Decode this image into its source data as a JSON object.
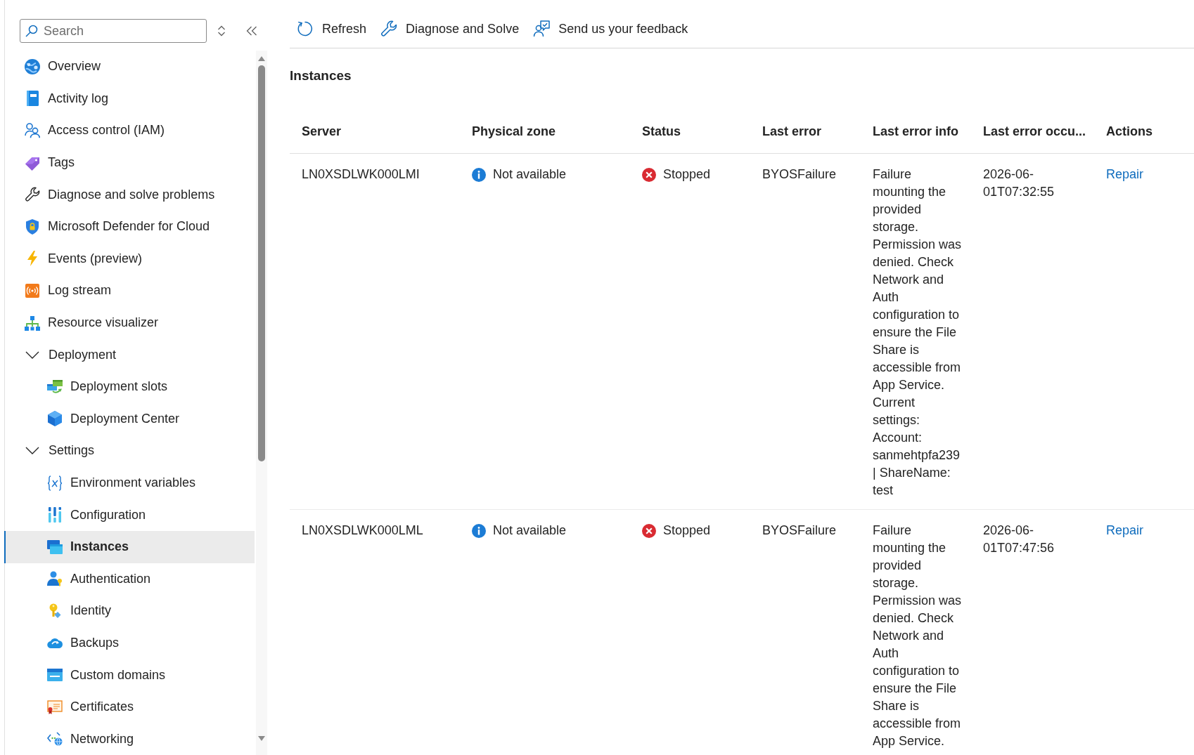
{
  "sidebar": {
    "search": {
      "placeholder": "Search"
    },
    "items": [
      {
        "label": "Overview",
        "selected": false
      },
      {
        "label": "Activity log",
        "selected": false
      },
      {
        "label": "Access control (IAM)",
        "selected": false
      },
      {
        "label": "Tags",
        "selected": false
      },
      {
        "label": "Diagnose and solve problems",
        "selected": false
      },
      {
        "label": "Microsoft Defender for Cloud",
        "selected": false
      },
      {
        "label": "Events (preview)",
        "selected": false
      },
      {
        "label": "Log stream",
        "selected": false
      },
      {
        "label": "Resource visualizer",
        "selected": false
      },
      {
        "label": "Deployment",
        "selected": false,
        "expanded": true,
        "children": [
          {
            "label": "Deployment slots",
            "selected": false
          },
          {
            "label": "Deployment Center",
            "selected": false
          }
        ]
      },
      {
        "label": "Settings",
        "selected": false,
        "expanded": true,
        "children": [
          {
            "label": "Environment variables",
            "selected": false
          },
          {
            "label": "Configuration",
            "selected": false
          },
          {
            "label": "Instances",
            "selected": true
          },
          {
            "label": "Authentication",
            "selected": false
          },
          {
            "label": "Identity",
            "selected": false
          },
          {
            "label": "Backups",
            "selected": false
          },
          {
            "label": "Custom domains",
            "selected": false
          },
          {
            "label": "Certificates",
            "selected": false
          },
          {
            "label": "Networking",
            "selected": false
          }
        ]
      }
    ]
  },
  "toolbar": [
    {
      "label": "Refresh"
    },
    {
      "label": "Diagnose and Solve"
    },
    {
      "label": "Send us your feedback"
    }
  ],
  "content": {
    "title": "Instances",
    "table": {
      "columns": [
        "Server",
        "Physical zone",
        "Status",
        "Last error",
        "Last error info",
        "Last error occu...",
        "Actions"
      ],
      "rows": [
        {
          "server": "LN0XSDLWK000LMI",
          "physical_zone": "Not available",
          "status": "Stopped",
          "last_error": "BYOSFailure",
          "last_error_info": "Failure mounting the provided storage. Permission was denied. Check Network and Auth configuration to ensure the File Share is accessible from App Service. Current settings: Account: sanmehtpfa239 | ShareName: test",
          "column_6": "2026-06-01T07:32:55",
          "action": "Repair"
        },
        {
          "server": "LN0XSDLWK000LML",
          "physical_zone": "Not available",
          "status": "Stopped",
          "last_error": "BYOSFailure",
          "last_error_info": "Failure mounting the provided storage. Permission was denied. Check Network and Auth configuration to ensure the File Share is accessible from App Service.",
          "column_6": "2026-06-01T07:47:56",
          "action": "Repair"
        }
      ]
    }
  }
}
